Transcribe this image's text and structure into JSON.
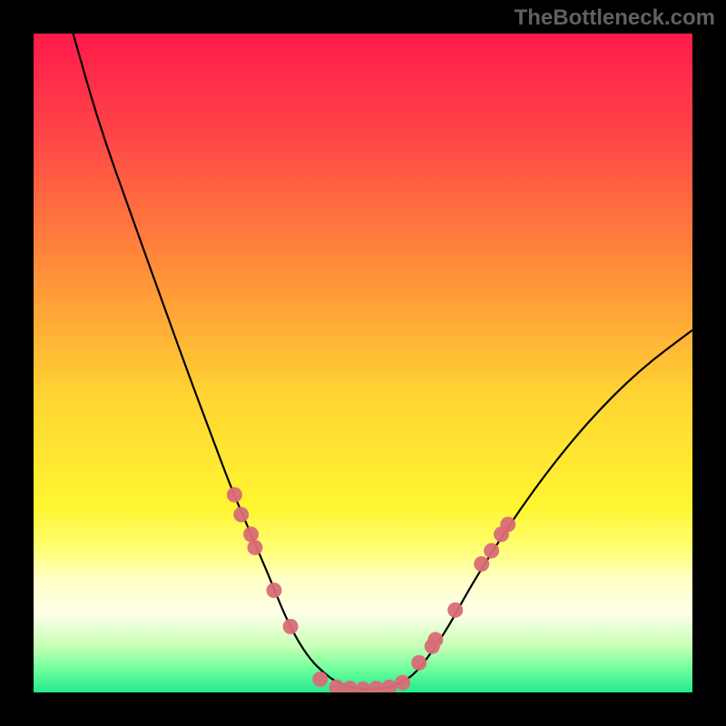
{
  "watermark": "TheBottleneck.com",
  "chart_data": {
    "type": "line",
    "title": "",
    "xlabel": "",
    "ylabel": "",
    "xlim": [
      0,
      100
    ],
    "ylim": [
      0,
      100
    ],
    "grid": false,
    "series": [
      {
        "name": "curve",
        "x": [
          6,
          10,
          15,
          20,
          24,
          27,
          30,
          33,
          36,
          38,
          40,
          42,
          44,
          46,
          49,
          53,
          56,
          58,
          60,
          63,
          66,
          70,
          74,
          78,
          82,
          86,
          90,
          94,
          98,
          100
        ],
        "y": [
          100,
          86,
          72,
          58,
          47,
          39,
          31,
          24,
          17,
          12,
          8,
          5,
          3,
          1.5,
          0.5,
          0.5,
          1.5,
          3,
          5.5,
          10,
          15.5,
          22,
          28,
          33.5,
          38.5,
          43,
          47,
          50.5,
          53.5,
          55
        ]
      }
    ],
    "markers": {
      "color": "#d96b77",
      "points": [
        {
          "x": 30.5,
          "y": 30
        },
        {
          "x": 31.5,
          "y": 27
        },
        {
          "x": 33,
          "y": 24
        },
        {
          "x": 33.6,
          "y": 22
        },
        {
          "x": 36.5,
          "y": 15.5
        },
        {
          "x": 39,
          "y": 10
        },
        {
          "x": 43.5,
          "y": 2
        },
        {
          "x": 46,
          "y": 0.8
        },
        {
          "x": 48,
          "y": 0.6
        },
        {
          "x": 50,
          "y": 0.5
        },
        {
          "x": 52,
          "y": 0.6
        },
        {
          "x": 54,
          "y": 0.8
        },
        {
          "x": 56,
          "y": 1.5
        },
        {
          "x": 58.5,
          "y": 4.5
        },
        {
          "x": 60.5,
          "y": 7
        },
        {
          "x": 61,
          "y": 8
        },
        {
          "x": 64,
          "y": 12.5
        },
        {
          "x": 68,
          "y": 19.5
        },
        {
          "x": 69.5,
          "y": 21.5
        },
        {
          "x": 71,
          "y": 24
        },
        {
          "x": 72,
          "y": 25.5
        }
      ]
    },
    "background": {
      "gradient_stops": [
        {
          "pos": 0.0,
          "color": "#ff1a4a"
        },
        {
          "pos": 0.15,
          "color": "#ff4447"
        },
        {
          "pos": 0.35,
          "color": "#ff8b3a"
        },
        {
          "pos": 0.55,
          "color": "#ffd433"
        },
        {
          "pos": 0.72,
          "color": "#fff631"
        },
        {
          "pos": 0.78,
          "color": "#ffff73"
        },
        {
          "pos": 0.83,
          "color": "#ffffc8"
        },
        {
          "pos": 0.88,
          "color": "#feffe8"
        },
        {
          "pos": 0.93,
          "color": "#c6ffb6"
        },
        {
          "pos": 0.965,
          "color": "#6fff9c"
        },
        {
          "pos": 1.0,
          "color": "#22e88f"
        }
      ]
    }
  }
}
